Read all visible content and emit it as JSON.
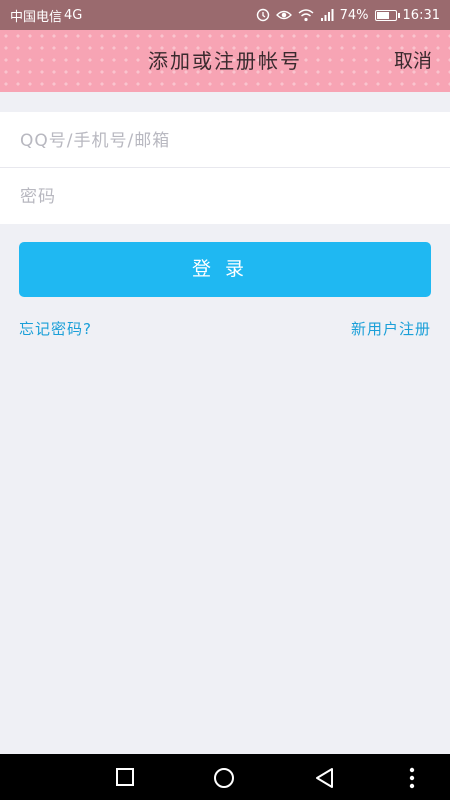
{
  "status_bar": {
    "carrier": "中国电信",
    "network": "4G",
    "battery": "74%",
    "battery_level": 0.74,
    "time": "16:31"
  },
  "header": {
    "title": "添加或注册帐号",
    "cancel_label": "取消"
  },
  "form": {
    "username_placeholder": "QQ号/手机号/邮箱",
    "password_placeholder": "密码",
    "login_label": "登录",
    "forgot_label": "忘记密码?",
    "register_label": "新用户注册"
  },
  "colors": {
    "header_bg": "#f7a4b4",
    "button_bg": "#1fb8f2",
    "link": "#1a9fd8",
    "background": "#eff0f5"
  },
  "nav_bar": {
    "icons": [
      "recent-apps-icon",
      "home-icon",
      "back-icon",
      "more-icon"
    ]
  }
}
